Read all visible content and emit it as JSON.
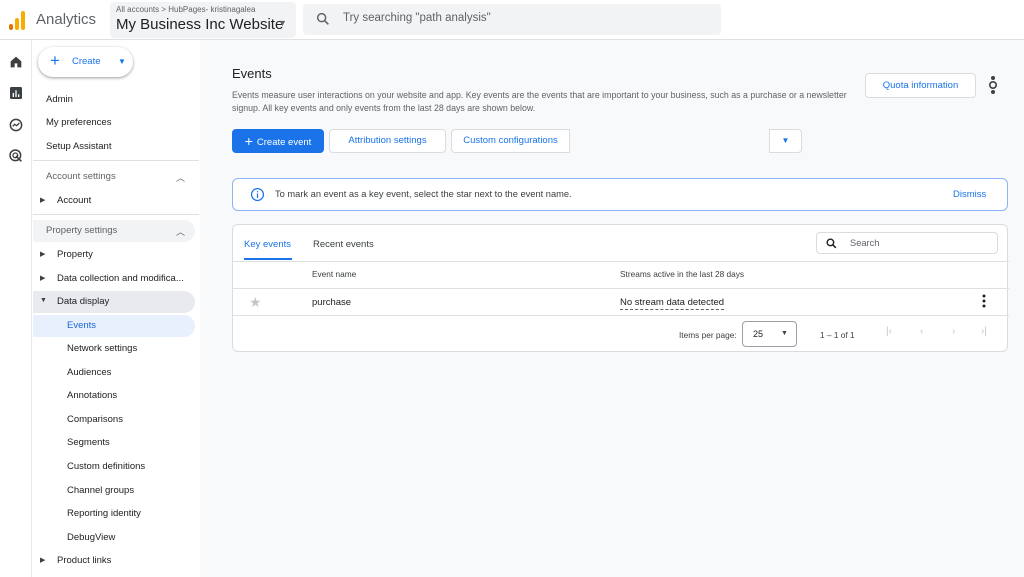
{
  "header": {
    "app_name": "Analytics",
    "breadcrumb": "All accounts > HubPages- kristinagalea",
    "property_name": "My Business Inc Website",
    "search_placeholder": "Try searching \"path analysis\""
  },
  "colors": {
    "brand_blue": "#1a73e8",
    "logo_orange": "#f9ab00",
    "logo_dark_orange": "#e37400"
  },
  "rail": {
    "icons": [
      "home-icon",
      "reports-icon",
      "explore-icon",
      "advertising-icon"
    ]
  },
  "sidebar": {
    "create_label": "Create",
    "top_items": [
      "Admin",
      "My preferences",
      "Setup Assistant"
    ],
    "account_settings": {
      "label": "Account settings",
      "items": [
        "Account"
      ]
    },
    "property_settings": {
      "label": "Property settings",
      "items": [
        "Property",
        "Data collection and modifica...",
        "Data display"
      ],
      "data_display_children": [
        "Events",
        "Network settings",
        "Audiences",
        "Annotations",
        "Comparisons",
        "Segments",
        "Custom definitions",
        "Channel groups",
        "Reporting identity",
        "DebugView"
      ],
      "after": [
        "Product links"
      ]
    },
    "active_item": "Events"
  },
  "main": {
    "title": "Events",
    "description": "Events measure user interactions on your website and app. Key events are the events that are important to your business, such as a purchase or a newsletter signup. All key events and only events from the last 28 days are shown below.",
    "quota_button": "Quota information",
    "create_event_button": "Create event",
    "attribution_button": "Attribution settings",
    "custom_config_button": "Custom configurations",
    "banner": {
      "message": "To mark an event as a key event, select the star next to the event name.",
      "dismiss": "Dismiss"
    },
    "tabs": [
      {
        "label": "Key events",
        "active": true
      },
      {
        "label": "Recent events",
        "active": false
      }
    ],
    "table_search_placeholder": "Search",
    "columns": [
      "Event name",
      "Streams active in the last 28 days"
    ],
    "rows": [
      {
        "event_name": "purchase",
        "streams": "No stream data detected",
        "key_event": false
      }
    ],
    "pagination": {
      "items_per_page_label": "Items per page:",
      "items_per_page": "25",
      "range": "1 – 1 of 1"
    }
  }
}
